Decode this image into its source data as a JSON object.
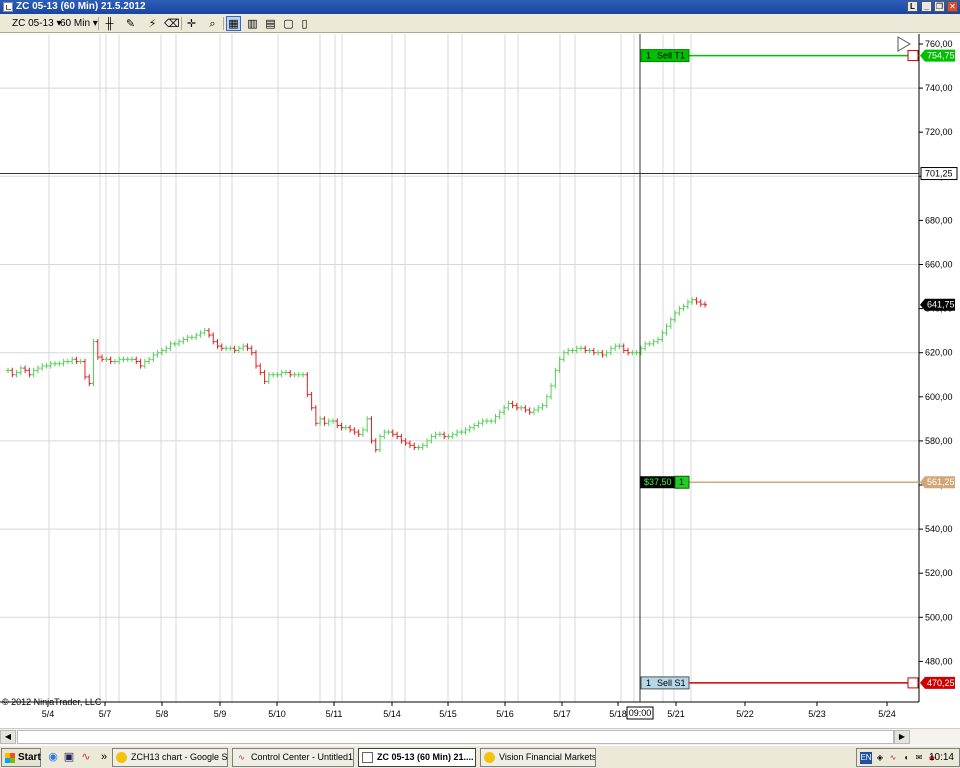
{
  "window": {
    "title": "ZC 05-13 (60 Min)  21.5.2012",
    "controls": [
      "L",
      "_",
      "❐",
      "✕"
    ]
  },
  "toolbar": {
    "instrument": "ZC 05-13",
    "interval": "60 Min"
  },
  "chart": {
    "copyright": "© 2012 NinjaTrader, LLC",
    "y_ticks": [
      "760,00",
      "740,00",
      "720,00",
      "700,00",
      "680,00",
      "660,00",
      "640,00",
      "620,00",
      "600,00",
      "580,00",
      "560,00",
      "540,00",
      "520,00",
      "500,00",
      "480,00"
    ],
    "x_ticks": [
      "5/4",
      "5/7",
      "5/8",
      "5/9",
      "5/10",
      "5/11",
      "5/14",
      "5/15",
      "5/16",
      "5/17",
      "5/18",
      "5/21",
      "5/22",
      "5/23",
      "5/24"
    ],
    "crosshair_time": "09:00",
    "crosshair_price": "701,25",
    "last_price": "641,75",
    "orders": {
      "target": {
        "qty": "1",
        "name": "Sell T1",
        "price": "754,75",
        "color": "#00c000"
      },
      "position": {
        "pnl": "$37,50",
        "qty": "1",
        "price": "561,25",
        "color": "#d2a679"
      },
      "stop": {
        "qty": "1",
        "name": "Sell S1",
        "price": "470,25",
        "color": "#d00000"
      }
    },
    "colors": {
      "up": "#55d055",
      "down": "#e02020",
      "grid": "#d8d8d8"
    }
  },
  "chart_data": {
    "type": "candlestick",
    "ylim": [
      470,
      760
    ],
    "note_free": true,
    "series": [
      {
        "points": [
          [
            612,
            612
          ],
          [
            612,
            610
          ],
          [
            610,
            611
          ],
          [
            611,
            613
          ],
          [
            613,
            612
          ],
          [
            612,
            610
          ],
          [
            610,
            612
          ],
          [
            612,
            613
          ],
          [
            613,
            614
          ],
          [
            614,
            614
          ],
          [
            614,
            615
          ],
          [
            615,
            615
          ],
          [
            615,
            615
          ],
          [
            615,
            616
          ],
          [
            616,
            616
          ],
          [
            616,
            617
          ],
          [
            617,
            616
          ],
          [
            616,
            616
          ],
          [
            616,
            609
          ],
          [
            609,
            606
          ],
          [
            606,
            625
          ],
          [
            625,
            618
          ],
          [
            618,
            617
          ],
          [
            617,
            617
          ],
          [
            617,
            616
          ],
          [
            616,
            616
          ],
          [
            616,
            617
          ],
          [
            617,
            617
          ],
          [
            617,
            617
          ],
          [
            617,
            617
          ],
          [
            617,
            616
          ],
          [
            616,
            614
          ],
          [
            614,
            616
          ],
          [
            616,
            617
          ],
          [
            617,
            619
          ],
          [
            619,
            620
          ],
          [
            620,
            621
          ],
          [
            621,
            622
          ],
          [
            622,
            624
          ],
          [
            624,
            624
          ],
          [
            624,
            625
          ],
          [
            625,
            626
          ],
          [
            626,
            627
          ],
          [
            627,
            627
          ],
          [
            627,
            628
          ],
          [
            628,
            629
          ],
          [
            629,
            630
          ],
          [
            630,
            628
          ],
          [
            628,
            625
          ],
          [
            625,
            623
          ],
          [
            623,
            622
          ],
          [
            622,
            622
          ],
          [
            622,
            622
          ],
          [
            622,
            621
          ],
          [
            621,
            622
          ],
          [
            622,
            623
          ],
          [
            623,
            622
          ],
          [
            622,
            620
          ],
          [
            620,
            614
          ],
          [
            614,
            611
          ],
          [
            611,
            607
          ],
          [
            607,
            610
          ],
          [
            610,
            610
          ],
          [
            610,
            610
          ],
          [
            610,
            611
          ],
          [
            611,
            611
          ],
          [
            611,
            610
          ],
          [
            610,
            610
          ],
          [
            610,
            610
          ],
          [
            610,
            610
          ],
          [
            610,
            601
          ],
          [
            601,
            595
          ],
          [
            595,
            588
          ],
          [
            588,
            590
          ],
          [
            590,
            588
          ],
          [
            588,
            589
          ],
          [
            589,
            589
          ],
          [
            589,
            587
          ],
          [
            587,
            586
          ],
          [
            586,
            586
          ],
          [
            586,
            585
          ],
          [
            585,
            584
          ],
          [
            584,
            583
          ],
          [
            583,
            585
          ],
          [
            585,
            590
          ],
          [
            590,
            580
          ],
          [
            580,
            576
          ],
          [
            576,
            582
          ],
          [
            582,
            584
          ],
          [
            584,
            584
          ],
          [
            584,
            583
          ],
          [
            583,
            582
          ],
          [
            582,
            580
          ],
          [
            580,
            579
          ],
          [
            579,
            578
          ],
          [
            578,
            577
          ],
          [
            577,
            577
          ],
          [
            577,
            578
          ],
          [
            578,
            580
          ],
          [
            580,
            582
          ],
          [
            582,
            583
          ],
          [
            583,
            583
          ],
          [
            583,
            582
          ],
          [
            582,
            582
          ],
          [
            582,
            583
          ],
          [
            583,
            584
          ],
          [
            584,
            584
          ],
          [
            584,
            585
          ],
          [
            585,
            586
          ],
          [
            586,
            587
          ],
          [
            587,
            588
          ],
          [
            588,
            589
          ],
          [
            589,
            589
          ],
          [
            589,
            589
          ],
          [
            589,
            591
          ],
          [
            591,
            593
          ],
          [
            593,
            595
          ],
          [
            595,
            597
          ],
          [
            597,
            596
          ],
          [
            596,
            595
          ],
          [
            595,
            595
          ],
          [
            595,
            594
          ],
          [
            594,
            593
          ],
          [
            593,
            594
          ],
          [
            594,
            595
          ],
          [
            595,
            596
          ],
          [
            596,
            600
          ],
          [
            600,
            605
          ],
          [
            605,
            612
          ],
          [
            612,
            617
          ],
          [
            617,
            620
          ],
          [
            620,
            621
          ],
          [
            621,
            621
          ],
          [
            621,
            622
          ],
          [
            622,
            622
          ],
          [
            622,
            621
          ],
          [
            621,
            621
          ],
          [
            621,
            620
          ],
          [
            620,
            620
          ],
          [
            620,
            619
          ],
          [
            619,
            620
          ],
          [
            620,
            622
          ],
          [
            622,
            623
          ],
          [
            623,
            623
          ],
          [
            623,
            621
          ],
          [
            621,
            620
          ],
          [
            620,
            620
          ],
          [
            620,
            620
          ],
          [
            620,
            622
          ],
          [
            622,
            624
          ],
          [
            624,
            624
          ],
          [
            624,
            625
          ],
          [
            625,
            626
          ],
          [
            626,
            629
          ],
          [
            629,
            632
          ],
          [
            632,
            635
          ],
          [
            635,
            638
          ],
          [
            638,
            640
          ],
          [
            640,
            641
          ],
          [
            641,
            643
          ],
          [
            643,
            644
          ],
          [
            644,
            643
          ],
          [
            643,
            642
          ],
          [
            642,
            641.75
          ]
        ]
      }
    ]
  }
}
